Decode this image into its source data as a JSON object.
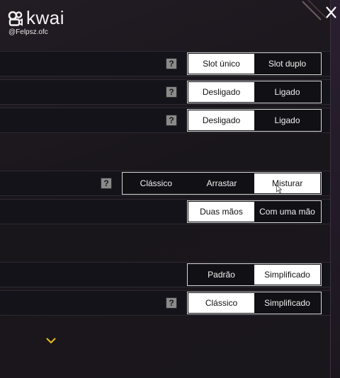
{
  "watermark": {
    "brand": "kwai",
    "handle": "@Felpsz.ofc"
  },
  "settings": [
    {
      "name": "slot-mode",
      "has_help": true,
      "options": [
        "Slot único",
        "Slot duplo"
      ],
      "selected": 0
    },
    {
      "name": "toggle-1",
      "has_help": true,
      "options": [
        "Desligado",
        "Ligado"
      ],
      "selected": 0
    },
    {
      "name": "toggle-2",
      "has_help": true,
      "options": [
        "Desligado",
        "Ligado"
      ],
      "selected": 0
    },
    {
      "name": "control-mode",
      "has_help": true,
      "options": [
        "Clássico",
        "Arrastar",
        "Misturar"
      ],
      "selected": 2
    },
    {
      "name": "hands-mode",
      "has_help": false,
      "options": [
        "Duas mãos",
        "Com uma mão"
      ],
      "selected": 0
    },
    {
      "name": "display-mode",
      "has_help": false,
      "options": [
        "Padrão",
        "Simplificado"
      ],
      "selected": 1
    },
    {
      "name": "style-mode",
      "has_help": true,
      "options": [
        "Clássico",
        "Simplificado"
      ],
      "selected": 0
    }
  ],
  "help_glyph": "?",
  "colors": {
    "background": "#1b171d",
    "row": "#15131a",
    "selected": "#ffffff",
    "watermark_accent": "#f0c020"
  }
}
